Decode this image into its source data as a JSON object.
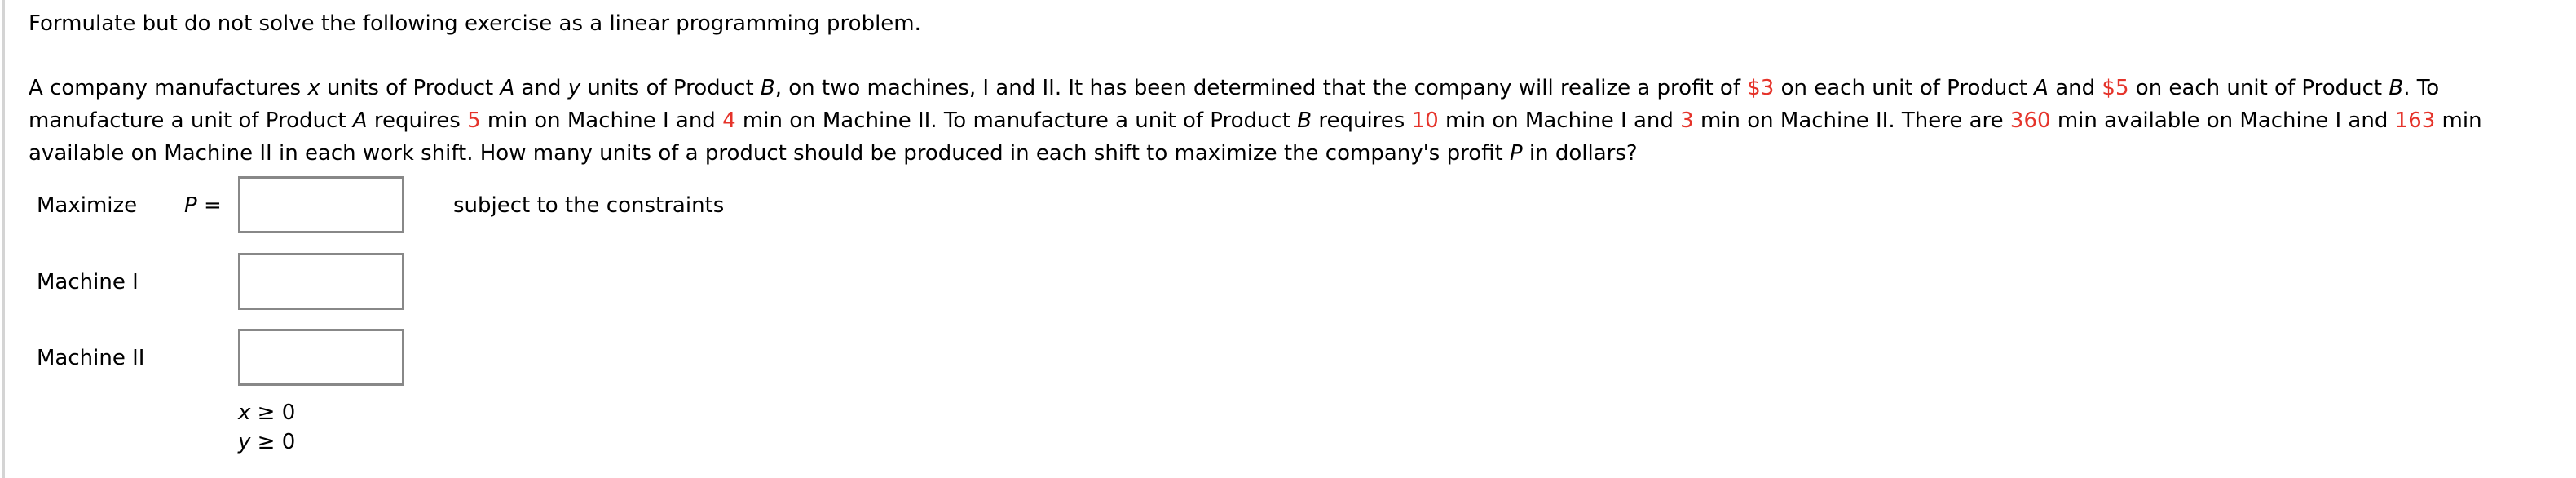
{
  "instruction": "Formulate but do not solve the following exercise as a linear programming problem.",
  "problem": {
    "lines": [
      [
        {
          "t": "A company manufactures "
        },
        {
          "t": "x",
          "style": "it"
        },
        {
          "t": " units of Product "
        },
        {
          "t": "A",
          "style": "it"
        },
        {
          "t": " and "
        },
        {
          "t": "y",
          "style": "it"
        },
        {
          "t": " units of Product "
        },
        {
          "t": "B",
          "style": "it"
        },
        {
          "t": ", on two machines, I and II. It has been determined that the company will realize a profit of "
        },
        {
          "t": "$3",
          "style": "hl"
        },
        {
          "t": " on each unit of Product "
        },
        {
          "t": "A",
          "style": "it"
        },
        {
          "t": " and "
        },
        {
          "t": "$5",
          "style": "hl"
        },
        {
          "t": " on each unit of Product "
        },
        {
          "t": "B",
          "style": "it"
        },
        {
          "t": ". To"
        }
      ],
      [
        {
          "t": "manufacture a unit of Product "
        },
        {
          "t": "A",
          "style": "it"
        },
        {
          "t": " requires "
        },
        {
          "t": "5",
          "style": "hl"
        },
        {
          "t": " min on Machine I and "
        },
        {
          "t": "4",
          "style": "hl"
        },
        {
          "t": " min on Machine II. To manufacture a unit of Product "
        },
        {
          "t": "B",
          "style": "it"
        },
        {
          "t": " requires "
        },
        {
          "t": "10",
          "style": "hl"
        },
        {
          "t": " min on Machine I and "
        },
        {
          "t": "3",
          "style": "hl"
        },
        {
          "t": " min on Machine II. There are "
        },
        {
          "t": "360",
          "style": "hl"
        },
        {
          "t": " min available on Machine I and "
        },
        {
          "t": "163",
          "style": "hl"
        },
        {
          "t": " min"
        }
      ],
      [
        {
          "t": "available on Machine II in each work shift. How many units of a product should be produced in each shift to maximize the company's profit "
        },
        {
          "t": "P",
          "style": "it"
        },
        {
          "t": " in dollars?"
        }
      ]
    ],
    "values": {
      "profit_per_unit_A": "$3",
      "profit_per_unit_B": "$5",
      "product_A_machine_I_min": "5",
      "product_A_machine_II_min": "4",
      "product_B_machine_I_min": "10",
      "product_B_machine_II_min": "3",
      "machine_I_available_min": "360",
      "machine_II_available_min": "163"
    },
    "highlight_color": "#e5332a"
  },
  "form": {
    "maximize_label": "Maximize",
    "objective_var": "P",
    "objective_eq": " =",
    "objective_value": "",
    "subject_to_label": "subject to the constraints",
    "constraints": [
      {
        "label": "Machine I",
        "value": ""
      },
      {
        "label": "Machine II",
        "value": ""
      }
    ],
    "nonnegativity": [
      {
        "var": "x",
        "rel": " ≥ 0"
      },
      {
        "var": "y",
        "rel": " ≥ 0"
      }
    ]
  }
}
